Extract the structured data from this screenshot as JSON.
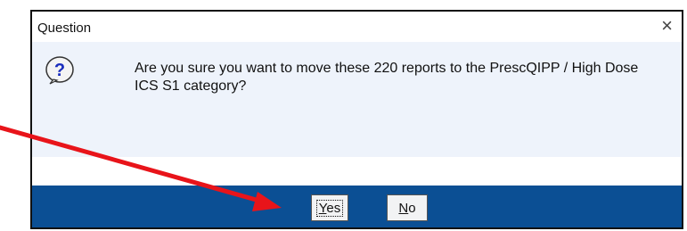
{
  "dialog": {
    "title": "Question",
    "close_glyph": "×",
    "icon": "question-icon",
    "message": "Are you sure you want to move these 220 reports to the PrescQIPP / High Dose ICS S1 category?",
    "buttons": {
      "yes_prefix": "",
      "yes_mnemonic": "Y",
      "yes_rest": "es",
      "no_prefix": "",
      "no_mnemonic": "N",
      "no_rest": "o"
    }
  },
  "colors": {
    "footer": "#0b4f94",
    "content_bg": "#eef3fb",
    "arrow": "#e8141a"
  }
}
